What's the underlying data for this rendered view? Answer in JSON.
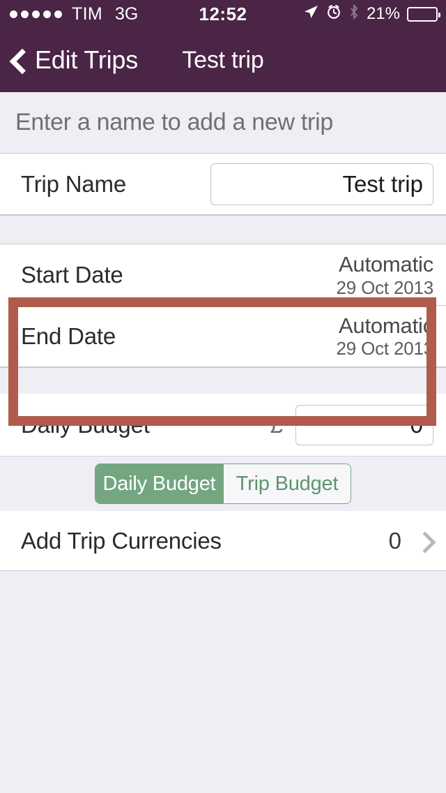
{
  "status_bar": {
    "signal_dots": 5,
    "carrier": "TIM",
    "network": "3G",
    "time": "12:52",
    "location_icon": "location-arrow-icon",
    "alarm_icon": "alarm-clock-icon",
    "bluetooth_icon": "bluetooth-icon",
    "battery_percent": "21%",
    "battery_level": 21
  },
  "nav_bar": {
    "back_icon": "chevron-left-icon",
    "back_label": "Edit Trips",
    "title": "Test trip"
  },
  "section_header": {
    "text": "Enter a name to add a new trip"
  },
  "trip_name": {
    "label": "Trip Name",
    "value": "Test trip",
    "placeholder": "Trip Name"
  },
  "dates": [
    {
      "label": "Start Date",
      "mode": "Automatic",
      "date": "29 Oct 2013"
    },
    {
      "label": "End Date",
      "mode": "Automatic",
      "date": "29 Oct 2013"
    }
  ],
  "budget": {
    "label": "Daily Budget",
    "currency_symbol": "£",
    "value": "0",
    "placeholder": "0",
    "segments": [
      {
        "label": "Daily Budget",
        "selected": true
      },
      {
        "label": "Trip Budget",
        "selected": false
      }
    ]
  },
  "currencies": {
    "label": "Add Trip Currencies",
    "count": "0",
    "disclosure_icon": "chevron-right-icon"
  },
  "colors": {
    "nav_background": "#4A2545",
    "highlight_border": "#B05B4C",
    "segment_accent": "#73A681",
    "page_background": "#EFEEF4",
    "cell_background": "#FFFFFF"
  }
}
